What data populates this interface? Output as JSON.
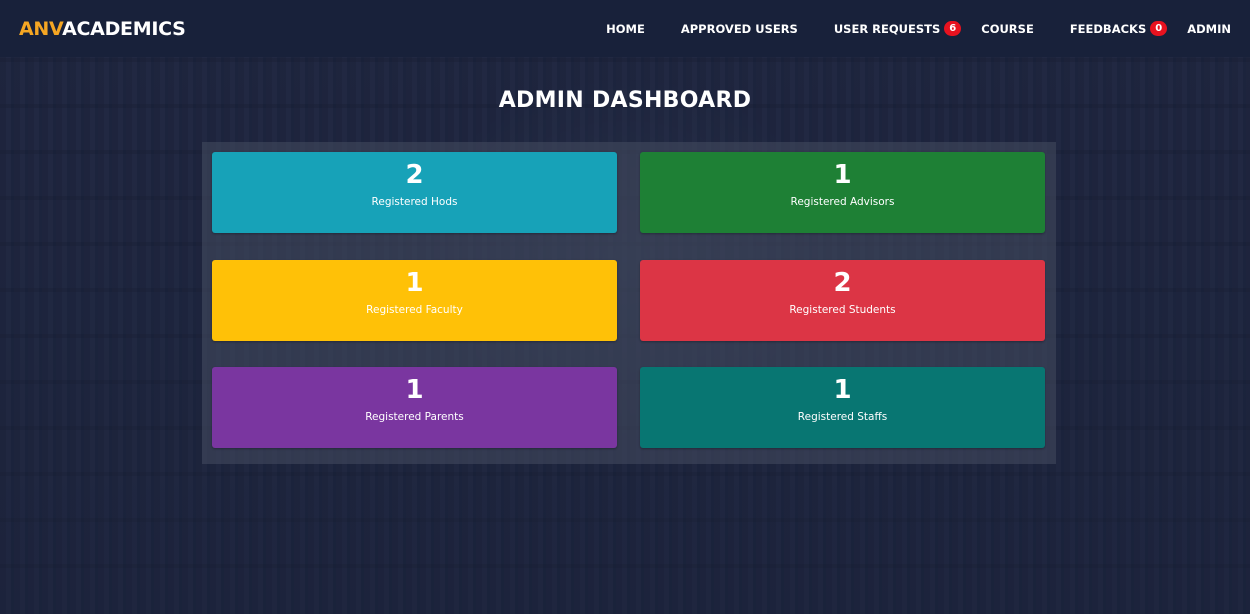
{
  "brand": {
    "accent": "ANV",
    "rest": "ACADEMICS"
  },
  "nav": {
    "home": "HOME",
    "approved_users": "APPROVED USERS",
    "user_requests": "USER REQUESTS",
    "user_requests_count": "6",
    "course": "COURSE",
    "feedbacks": "FEEDBACKS",
    "feedbacks_count": "0",
    "admin": "ADMIN"
  },
  "page_title": "ADMIN DASHBOARD",
  "cards": [
    {
      "count": "2",
      "label": "Registered Hods",
      "color": "#17a2b8"
    },
    {
      "count": "1",
      "label": "Registered Advisors",
      "color": "#1e8035"
    },
    {
      "count": "1",
      "label": "Registered Faculty",
      "color": "#ffc107"
    },
    {
      "count": "2",
      "label": "Registered Students",
      "color": "#dc3545"
    },
    {
      "count": "1",
      "label": "Registered Parents",
      "color": "#7a36a0"
    },
    {
      "count": "1",
      "label": "Registered Staffs",
      "color": "#087672"
    }
  ],
  "colors": {
    "navbar": "#18213a",
    "brand_accent": "#f5a623",
    "badge": "#e8121f"
  }
}
